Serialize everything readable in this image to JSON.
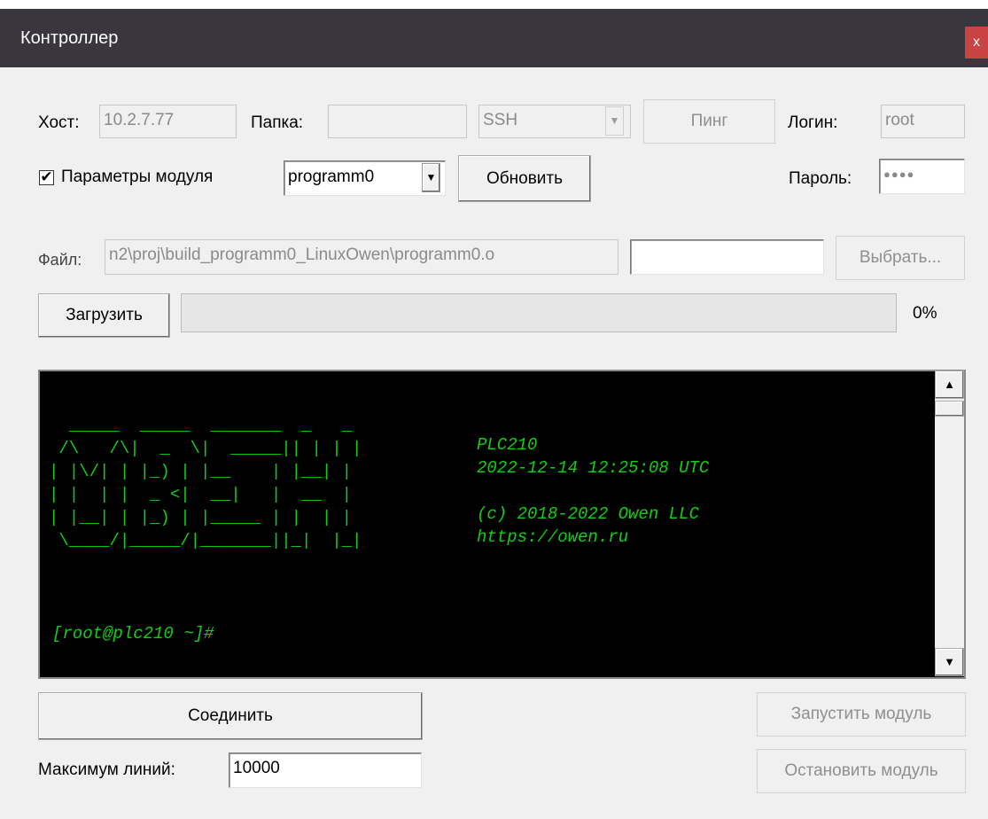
{
  "window": {
    "title": "Контроллер",
    "close_glyph": "x"
  },
  "host": {
    "label": "Хост:",
    "value": "10.2.7.77"
  },
  "folder": {
    "label": "Папка:",
    "value": ""
  },
  "protocol": {
    "selected": "SSH"
  },
  "ping_button": "Пинг",
  "login": {
    "label": "Логин:",
    "value": "root"
  },
  "module_params": {
    "label": "Параметры модуля",
    "checked": true,
    "check_glyph": "✔"
  },
  "module_select": {
    "selected": "programm0"
  },
  "refresh_button": "Обновить",
  "password": {
    "label": "Пароль:",
    "value": "●●●●"
  },
  "file": {
    "label": "Файл:",
    "value": "n2\\proj\\build_programm0_LinuxOwen\\programm0.o",
    "extra": ""
  },
  "choose_button": "Выбрать...",
  "upload_button": "Загрузить",
  "upload_progress": {
    "text": "0%",
    "fraction": 0
  },
  "console": {
    "logo_lines": [
      "  _____  _____  _______  _   _",
      " /\\   /\\|  _  \\|  _____|| | | |",
      "| |\\/| | |_) | |__    | |__| |",
      "| |  | |  _ <|  __|   |  __  |",
      "| |__| | |_) | |_____ | |  | |",
      " \\____/|_____/|_______||_|  |_|"
    ],
    "info_lines": [
      "PLC210",
      "2022-12-14 12:25:08 UTC",
      "",
      "(c) 2018-2022 Owen LLC",
      "https://owen.ru"
    ],
    "prompt": "[root@plc210 ~]#"
  },
  "connect_button": "Соединить",
  "start_module_button": "Запустить модуль",
  "stop_module_button": "Остановить модуль",
  "max_lines": {
    "label": "Максимум линий:",
    "value": "10000"
  },
  "icons": {
    "dropdown": "▼",
    "scroll_up": "▲",
    "scroll_down": "▼"
  }
}
